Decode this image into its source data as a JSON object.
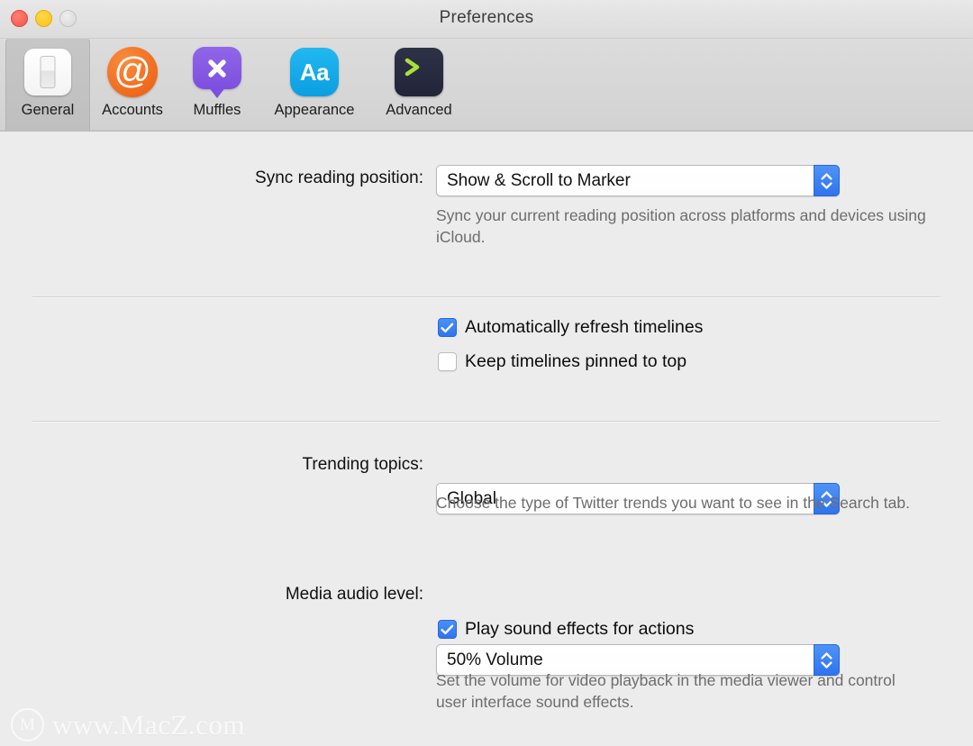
{
  "window": {
    "title": "Preferences",
    "controls": [
      {
        "name": "close",
        "color": "#f4554a"
      },
      {
        "name": "minimize",
        "color": "#fcc017"
      },
      {
        "name": "zoom",
        "color": "#d6d6d6"
      }
    ]
  },
  "toolbar": {
    "tabs": [
      {
        "label": "General",
        "icon": "switch-plate-icon",
        "selected": true
      },
      {
        "label": "Accounts",
        "icon": "at-sign-icon",
        "selected": false
      },
      {
        "label": "Muffles",
        "icon": "muted-bubble-icon",
        "selected": false
      },
      {
        "label": "Appearance",
        "icon": "typography-aa-icon",
        "selected": false
      },
      {
        "label": "Advanced",
        "icon": "terminal-prompt-icon",
        "selected": false
      }
    ],
    "appearance_icon_text": "Aa",
    "accounts_icon_text": "@"
  },
  "general": {
    "sync_reading_position": {
      "label": "Sync reading position:",
      "value": "Show & Scroll to Marker",
      "hint": "Sync your current reading position across platforms and devices using iCloud."
    },
    "auto_refresh": {
      "label": "Automatically refresh timelines",
      "checked": true
    },
    "keep_pinned": {
      "label": "Keep timelines pinned to top",
      "checked": false
    },
    "trending_topics": {
      "label": "Trending topics:",
      "value": "Global",
      "hint": "Choose the type of Twitter trends you want to see in the Search tab."
    },
    "media_audio_level": {
      "label": "Media audio level:",
      "value": "50% Volume",
      "hint": "Set the volume for video playback in the media viewer and control user interface sound effects."
    },
    "play_sound_effects": {
      "label": "Play sound effects for actions",
      "checked": true
    }
  },
  "watermark": {
    "logo_letter": "M",
    "text": "www.MacZ.com"
  },
  "colors": {
    "accent": "#2f74f0",
    "stepper": "#3a7cf3",
    "window_bg": "#ececec",
    "toolbar_bg": "#d6d6d6",
    "hint_text": "#6d6d6d"
  }
}
